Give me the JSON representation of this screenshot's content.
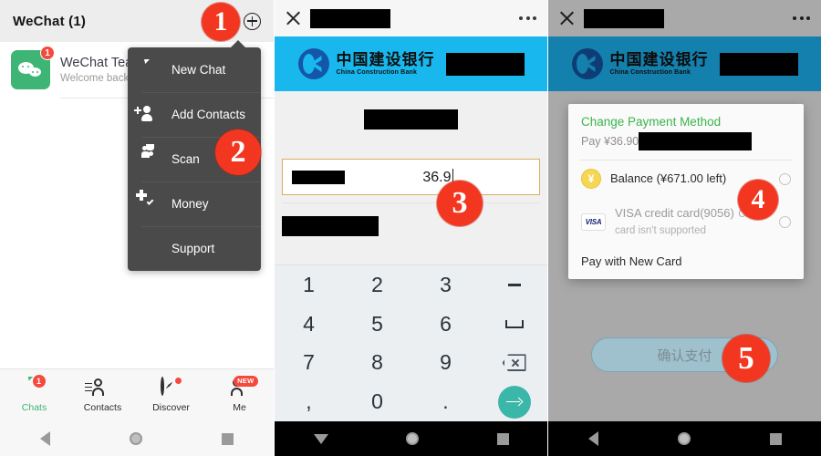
{
  "panel1": {
    "header": {
      "title": "WeChat (1)",
      "search_icon": "search-icon",
      "plus_icon": "plus-circle-icon"
    },
    "chat": {
      "name": "WeChat Tea",
      "subtitle": "Welcome back!",
      "unread_badge": "1",
      "avatar_icon": "wechat-logo-icon"
    },
    "dropdown": {
      "items": [
        {
          "label": "New Chat",
          "icon": "chat-bubble-icon"
        },
        {
          "label": "Add Contacts",
          "icon": "person-plus-icon"
        },
        {
          "label": "Scan",
          "icon": "scan-qr-icon"
        },
        {
          "label": "Money",
          "icon": "money-frame-icon"
        },
        {
          "label": "Support",
          "icon": "envelope-icon"
        }
      ]
    },
    "tabs": [
      {
        "label": "Chats",
        "icon": "chats-icon",
        "badge": "1",
        "active": true
      },
      {
        "label": "Contacts",
        "icon": "contacts-icon",
        "badge": "",
        "active": false
      },
      {
        "label": "Discover",
        "icon": "discover-compass-icon",
        "badge": "dot",
        "active": false
      },
      {
        "label": "Me",
        "icon": "me-person-icon",
        "badge": "NEW",
        "active": false
      }
    ],
    "navbar": {
      "back": "back-triangle-icon",
      "home": "home-circle-icon",
      "recents": "recents-square-icon"
    }
  },
  "panel2": {
    "topbar": {
      "close_icon": "close-x-icon",
      "title_redacted": "",
      "more_icon": "more-dots-icon"
    },
    "bank": {
      "name_cn": "中国建设银行",
      "name_en": "China Construction Bank",
      "logo_icon": "ccb-logo-icon"
    },
    "amount_field": {
      "label_redacted": "",
      "value": "36.9",
      "caret": true
    },
    "keypad": {
      "keys": [
        "1",
        "2",
        "3",
        "minus-key-icon",
        "4",
        "5",
        "6",
        "space-key-icon",
        "7",
        "8",
        "9",
        "backspace-key-icon",
        ",",
        "0",
        ".",
        "enter-arrow-icon"
      ]
    },
    "navbar": {
      "back": "keyboard-down-icon",
      "home": "home-circle-icon",
      "recents": "recents-square-icon"
    }
  },
  "panel3": {
    "topbar": {
      "close_icon": "close-x-icon",
      "title_redacted": "",
      "more_icon": "more-dots-icon"
    },
    "bank": {
      "name_cn": "中国建设银行",
      "name_en": "China Construction Bank",
      "logo_icon": "ccb-logo-icon"
    },
    "dialog": {
      "title": "Change Payment Method",
      "subtitle_prefix": "Pay ¥36.90(",
      "methods": [
        {
          "name": "Balance (¥671.00 left)",
          "note": "",
          "icon": "yuan-coin-icon",
          "selected": false,
          "disabled": false
        },
        {
          "name": "VISA credit card(9056)",
          "note": "Credit card isn't supported",
          "icon": "visa-card-icon",
          "selected": false,
          "disabled": true
        }
      ],
      "footer_action": "Pay with New Card"
    },
    "confirm_button": "确认支付",
    "navbar": {
      "back": "back-triangle-icon",
      "home": "home-circle-icon",
      "recents": "recents-square-icon"
    }
  },
  "step_badges": [
    {
      "number": "1"
    },
    {
      "number": "2"
    },
    {
      "number": "3"
    },
    {
      "number": "4"
    },
    {
      "number": "5"
    }
  ]
}
